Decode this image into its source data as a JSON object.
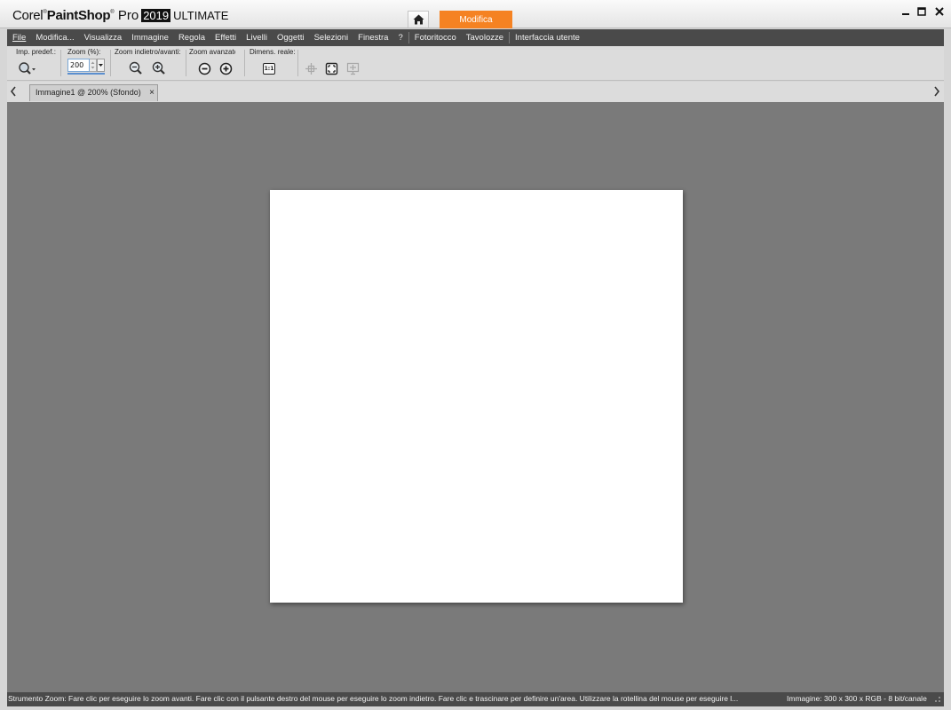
{
  "app": {
    "brand_corel": "Corel",
    "brand_psp": "PaintShop",
    "brand_pro": "Pro",
    "brand_year": "2019",
    "brand_edition": "ULTIMATE",
    "workspace_tab": "Modifica"
  },
  "menu": {
    "items": [
      "File",
      "Modifica...",
      "Visualizza",
      "Immagine",
      "Regola",
      "Effetti",
      "Livelli",
      "Oggetti",
      "Selezioni",
      "Finestra",
      "?"
    ],
    "items2": [
      "Fotoritocco",
      "Tavolozze"
    ],
    "items3": [
      "Interfaccia utente"
    ]
  },
  "toolbar": {
    "presets_label": "Imp. predef.:",
    "zoom_label": "Zoom (%):",
    "zoom_value": "200",
    "zoom_inout_label": "Zoom indietro/avanti:",
    "zoom_adv_label": "Zoom avanzato:",
    "actual_size_label": "Dimens. reale:",
    "actual_size_icon_text": "1:1"
  },
  "document": {
    "tab_label": "Immagine1 @ 200% (Sfondo)",
    "close_glyph": "×",
    "canvas_color": "#ffffff",
    "workspace_color": "#7a7a7a"
  },
  "status": {
    "message": "Strumento Zoom: Fare clic per eseguire lo zoom avanti. Fare clic con il pulsante destro del mouse per eseguire lo zoom indietro. Fare clic e trascinare per definire un'area. Utilizzare la rotellina del mouse per eseguire l...",
    "image_info": "Immagine:  300 x 300 x RGB - 8 bit/canale"
  },
  "colors": {
    "accent": "#f58222",
    "menubar": "#4a4a4a"
  }
}
